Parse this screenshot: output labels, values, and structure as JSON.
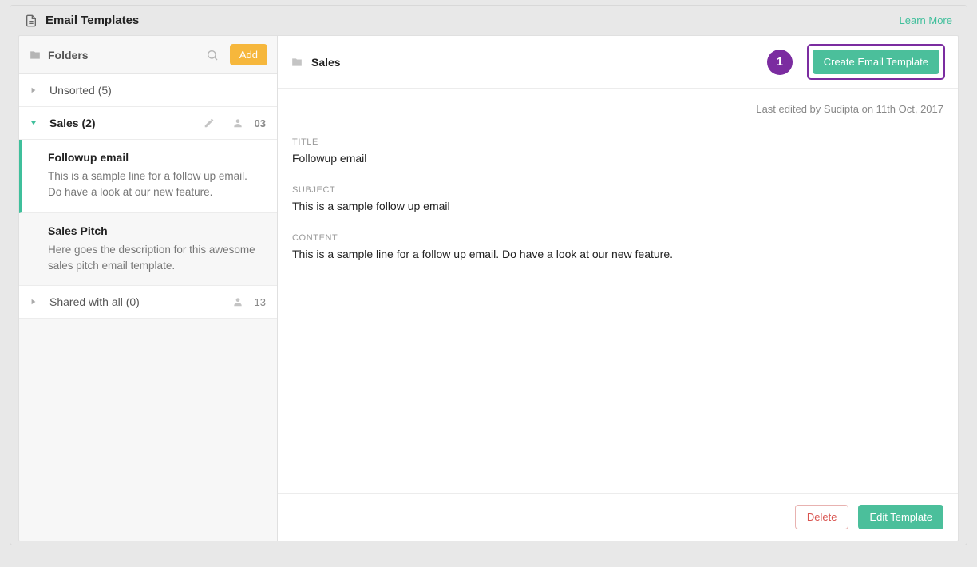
{
  "header": {
    "title": "Email Templates",
    "learn_more": "Learn More"
  },
  "sidebar": {
    "header_label": "Folders",
    "add_label": "Add",
    "folders": [
      {
        "name": "Unsorted",
        "count": "(5)",
        "expanded": false
      },
      {
        "name": "Sales",
        "count": "(2)",
        "expanded": true,
        "share_count": "03"
      },
      {
        "name": "Shared with all",
        "count": "(0)",
        "expanded": false,
        "share_count": "13"
      }
    ],
    "templates": [
      {
        "title": "Followup email",
        "desc": "This is a sample line for a follow up email. Do have a look at our new feature."
      },
      {
        "title": "Sales Pitch",
        "desc": "Here goes the description for this awesome sales pitch email template."
      }
    ]
  },
  "content": {
    "breadcrumb": "Sales",
    "annotation_number": "1",
    "create_label": "Create Email Template",
    "last_edited": "Last edited by Sudipta on 11th Oct, 2017",
    "labels": {
      "title": "TITLE",
      "subject": "SUBJECT",
      "content": "CONTENT"
    },
    "title_value": "Followup email",
    "subject_value": "This is a sample follow up email",
    "content_value": "This is a sample line for a follow up email. Do have a look at our new feature.",
    "delete_label": "Delete",
    "edit_label": "Edit Template"
  }
}
